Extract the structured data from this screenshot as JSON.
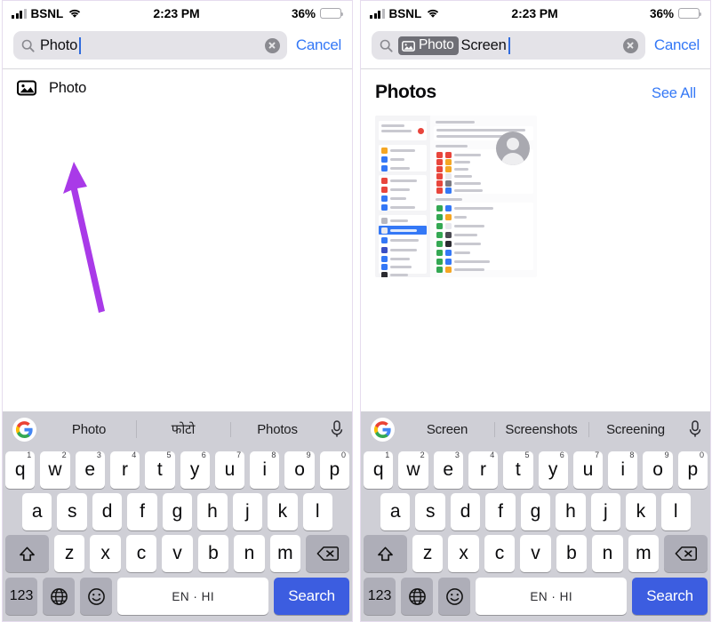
{
  "panels": [
    {
      "id": "left",
      "statusbar": {
        "carrier": "BSNL",
        "time": "2:23 PM",
        "battery_pct": "36%",
        "battery_level": 36
      },
      "search": {
        "text": "Photo",
        "token": null,
        "cancel_label": "Cancel",
        "has_clear": true,
        "has_caret": true
      },
      "results": [
        {
          "label": "Photo",
          "icon": "photo-icon"
        }
      ],
      "photos_section": null,
      "annotation": {
        "type": "arrow",
        "color": "#a93ae8"
      },
      "keyboard": {
        "suggestions": [
          "Photo",
          "फोटो",
          "Photos"
        ],
        "row1": [
          {
            "k": "q",
            "n": "1"
          },
          {
            "k": "w",
            "n": "2"
          },
          {
            "k": "e",
            "n": "3"
          },
          {
            "k": "r",
            "n": "4"
          },
          {
            "k": "t",
            "n": "5"
          },
          {
            "k": "y",
            "n": "6"
          },
          {
            "k": "u",
            "n": "7"
          },
          {
            "k": "i",
            "n": "8"
          },
          {
            "k": "o",
            "n": "9"
          },
          {
            "k": "p",
            "n": "0"
          }
        ],
        "row2": [
          "a",
          "s",
          "d",
          "f",
          "g",
          "h",
          "j",
          "k",
          "l"
        ],
        "row3": [
          "z",
          "x",
          "c",
          "v",
          "b",
          "n",
          "m"
        ],
        "numeric_label": "123",
        "space_label": "EN · HI",
        "action_label": "Search"
      }
    },
    {
      "id": "right",
      "statusbar": {
        "carrier": "BSNL",
        "time": "2:23 PM",
        "battery_pct": "36%",
        "battery_level": 36
      },
      "search": {
        "text": "Screen",
        "token": {
          "label": "Photo",
          "icon": "photo-icon"
        },
        "cancel_label": "Cancel",
        "has_clear": true,
        "has_caret": true
      },
      "results": [],
      "photos_section": {
        "title": "Photos",
        "see_all_label": "See All",
        "thumbnail_alt": "settings-screenshot-thumbnail"
      },
      "annotation": null,
      "keyboard": {
        "suggestions": [
          "Screen",
          "Screenshots",
          "Screening"
        ],
        "row1": [
          {
            "k": "q",
            "n": "1"
          },
          {
            "k": "w",
            "n": "2"
          },
          {
            "k": "e",
            "n": "3"
          },
          {
            "k": "r",
            "n": "4"
          },
          {
            "k": "t",
            "n": "5"
          },
          {
            "k": "y",
            "n": "6"
          },
          {
            "k": "u",
            "n": "7"
          },
          {
            "k": "i",
            "n": "8"
          },
          {
            "k": "o",
            "n": "9"
          },
          {
            "k": "p",
            "n": "0"
          }
        ],
        "row2": [
          "a",
          "s",
          "d",
          "f",
          "g",
          "h",
          "j",
          "k",
          "l"
        ],
        "row3": [
          "z",
          "x",
          "c",
          "v",
          "b",
          "n",
          "m"
        ],
        "numeric_label": "123",
        "space_label": "EN · HI",
        "action_label": "Search"
      }
    }
  ],
  "colors": {
    "accent_blue": "#3478f6",
    "key_action_blue": "#3c5de0",
    "keyboard_bg": "#cfcfd6",
    "search_field_bg": "#e4e3e8",
    "token_bg": "#6f6f76",
    "arrow_purple": "#a93ae8"
  }
}
